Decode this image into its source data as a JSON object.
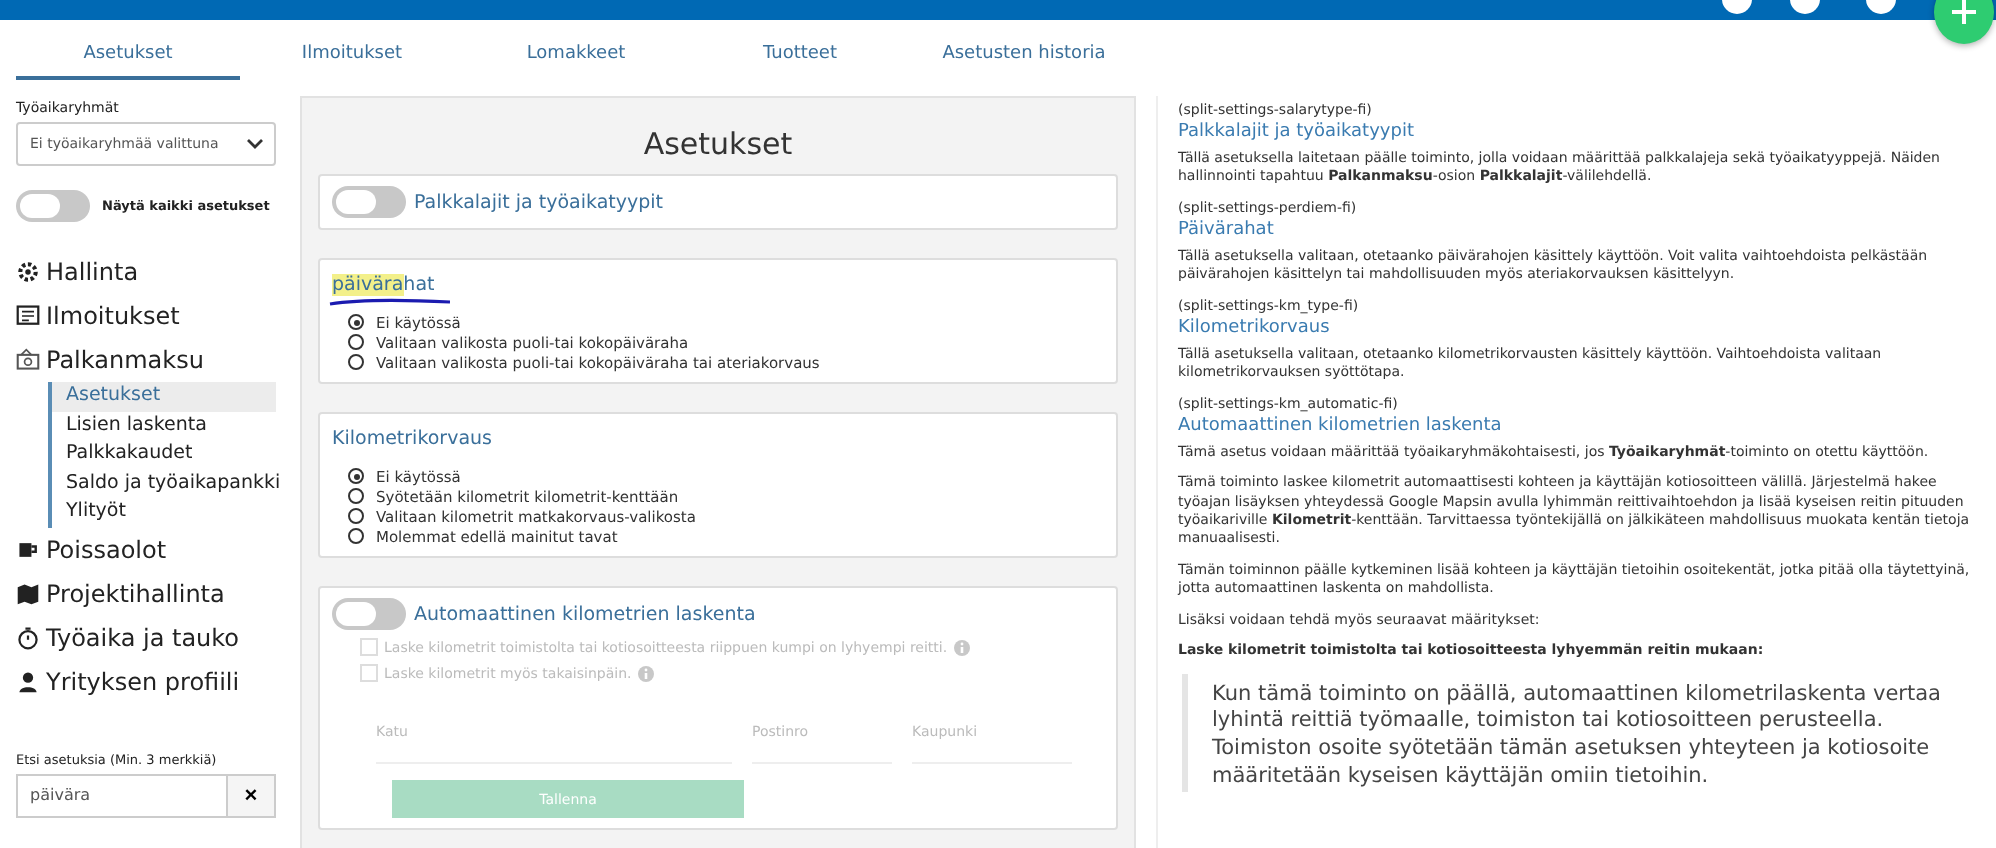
{
  "tabs": [
    {
      "label": "Asetukset",
      "selected": true
    },
    {
      "label": "Ilmoitukset",
      "selected": false
    },
    {
      "label": "Lomakkeet",
      "selected": false
    },
    {
      "label": "Tuotteet",
      "selected": false
    },
    {
      "label": "Asetusten historia",
      "selected": false
    }
  ],
  "sidebar": {
    "group_label": "Työaikaryhmät",
    "group_select": "Ei työaikaryhmää valittuna",
    "show_all": {
      "label": "Näytä kaikki asetukset",
      "on": false
    },
    "items": [
      {
        "label": "Hallinta"
      },
      {
        "label": "Ilmoitukset"
      },
      {
        "label": "Palkanmaksu",
        "children": [
          {
            "label": "Asetukset",
            "selected": true
          },
          {
            "label": "Lisien laskenta",
            "selected": false
          },
          {
            "label": "Palkkakaudet",
            "selected": false
          },
          {
            "label": "Saldo ja työaikapankki",
            "selected": false
          },
          {
            "label": "Ylityöt",
            "selected": false
          }
        ]
      },
      {
        "label": "Poissaolot"
      },
      {
        "label": "Projektihallinta"
      },
      {
        "label": "Työaika ja tauko"
      },
      {
        "label": "Yrityksen profiili"
      }
    ],
    "search_label": "Etsi asetuksia (Min. 3 merkkiä)",
    "search_value": "päivära",
    "clear": "×"
  },
  "settings": {
    "title": "Asetukset",
    "cards": [
      {
        "kind": "toggle",
        "title": "Palkkalajit ja työaikatyypit",
        "on": false
      },
      {
        "kind": "radio",
        "title_match": "päivära",
        "title_rest": "hat",
        "options": [
          {
            "label": "Ei käytössä",
            "selected": true
          },
          {
            "label": "Valitaan valikosta puoli-tai kokopäiväraha",
            "selected": false
          },
          {
            "label": "Valitaan valikosta puoli-tai kokopäiväraha tai ateriakorvaus",
            "selected": false
          }
        ]
      },
      {
        "kind": "radio",
        "title": "Kilometrikorvaus",
        "options": [
          {
            "label": "Ei käytössä",
            "selected": true
          },
          {
            "label": "Syötetään kilometrit kilometrit-kenttään",
            "selected": false
          },
          {
            "label": "Valitaan kilometrit matkakorvaus-valikosta",
            "selected": false
          },
          {
            "label": "Molemmat edellä mainitut tavat",
            "selected": false
          }
        ]
      },
      {
        "kind": "auto",
        "title": "Automaattinen kilometrien laskenta",
        "on": false,
        "checks": [
          {
            "label": "Laske kilometrit toimistolta tai kotiosoitteesta riippuen kumpi on lyhyempi reitti.",
            "checked": false,
            "disabled": true
          },
          {
            "label": "Laske kilometrit myös takaisinpäin.",
            "checked": false,
            "disabled": true
          }
        ],
        "fields": [
          {
            "placeholder": "Katu"
          },
          {
            "placeholder": "Postinro"
          },
          {
            "placeholder": "Kaupunki"
          }
        ],
        "save": "Tallenna",
        "save_disabled": true
      }
    ]
  },
  "help": [
    {
      "code": "(split-settings-salarytype-fi)",
      "title": "Palkkalajit ja työaikatyypit",
      "paragraphs": [
        {
          "kind": "text",
          "text": "Tällä asetuksella laitetaan päälle toiminto, jolla voidaan määrittää palkkalajeja sekä työaikatyyppejä. Näiden hallinnointi tapahtuu **Palkanmaksu**-osion **Palkkalajit**-välilehdellä."
        }
      ]
    },
    {
      "code": "(split-settings-perdiem-fi)",
      "title": "Päivärahat",
      "paragraphs": [
        {
          "kind": "text",
          "text": "Tällä asetuksella valitaan, otetaanko päivärahojen käsittely käyttöön. Voit valita vaihtoehdoista pelkästään päivärahojen käsittelyn tai mahdollisuuden myös ateriakorvauksen käsittelyyn."
        }
      ]
    },
    {
      "code": "(split-settings-km_type-fi)",
      "title": "Kilometrikorvaus",
      "paragraphs": [
        {
          "kind": "text",
          "text": "Tällä asetuksella valitaan, otetaanko kilometrikorvausten käsittely käyttöön. Vaihtoehdoista valitaan kilometrikorvauksen syöttötapa."
        }
      ]
    },
    {
      "code": "(split-settings-km_automatic-fi)",
      "title": "Automaattinen kilometrien laskenta",
      "paragraphs": [
        {
          "kind": "text",
          "text": "Tämä asetus voidaan määrittää työaikaryhmäkohtaisesti, jos **Työaikaryhmät**-toiminto on otettu käyttöön."
        },
        {
          "kind": "text",
          "text": "Tämä toiminto laskee kilometrit automaattisesti kohteen ja käyttäjän kotiosoitteen välillä. Järjestelmä hakee työajan lisäyksen yhteydessä Google Mapsin avulla lyhimmän reittivaihtoehdon ja lisää kyseisen reitin pituuden työaikariville **Kilometrit**-kenttään. Tarvittaessa työntekijällä on jälkikäteen mahdollisuus muokata kentän tietoja manuaalisesti."
        },
        {
          "kind": "text",
          "text": "Tämän toiminnon päälle kytkeminen lisää kohteen ja käyttäjän tietoihin osoitekentät, jotka pitää olla täytettyinä, jotta automaattinen laskenta on mahdollista."
        },
        {
          "kind": "text",
          "text": "Lisäksi voidaan tehdä myös seuraavat määritykset:"
        },
        {
          "kind": "heading",
          "text": "Laske kilometrit toimistolta tai kotiosoitteesta lyhyemmän reitin mukaan:"
        },
        {
          "kind": "quote",
          "text": "Kun tämä toiminto on päällä, automaattinen kilometrilaskenta vertaa lyhintä reittiä työmaalle, toimiston tai kotiosoitteen perusteella. Toimiston osoite syötetään tämän asetuksen yhteyteen ja kotiosoite määritetään kyseisen käyttäjän omiin tietoihin."
        }
      ]
    }
  ]
}
